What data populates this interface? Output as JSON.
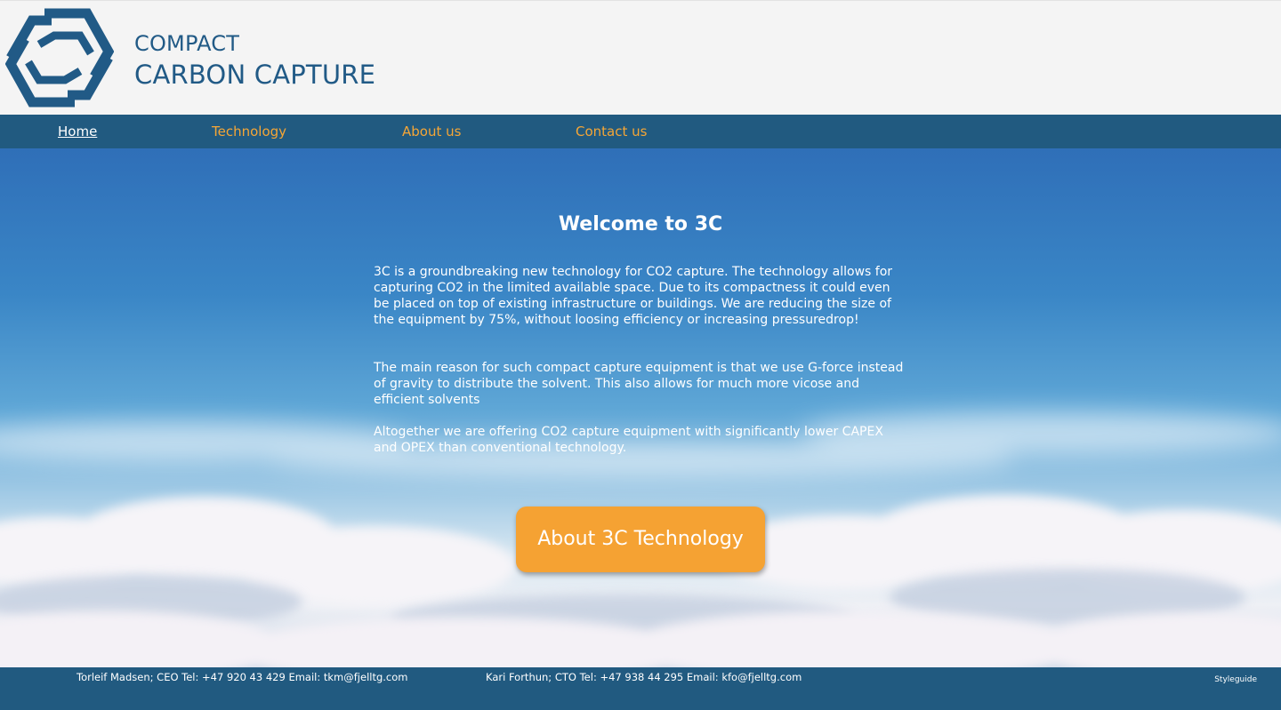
{
  "brand": {
    "line1": "COMPACT",
    "line2": "CARBON CAPTURE",
    "logo_icon": "hexagon-logo-icon",
    "color": "#215a86"
  },
  "nav": {
    "items": [
      {
        "label": "Home",
        "active": true
      },
      {
        "label": "Technology",
        "active": false
      },
      {
        "label": "About us",
        "active": false
      },
      {
        "label": "Contact us",
        "active": false
      }
    ],
    "background": "#215a80",
    "link_color": "#f5a636"
  },
  "hero": {
    "title": "Welcome to 3C",
    "paragraphs": [
      "3C is a groundbreaking new technology for CO2 capture. The technology allows for capturing CO2 in the limited available space. Due to its compactness it could even be placed on top of existing infrastructure or buildings. We are reducing the size of the equipment by 75%, without loosing efficiency or increasing pressuredrop!",
      "The main reason for such compact capture equipment is that we use G-force instead of gravity to distribute the solvent. This also allows for much more vicose and efficient solvents",
      "Altogether we are offering CO2 capture equipment with significantly lower CAPEX and OPEX than conventional technology."
    ],
    "cta_label": "About 3C Technology",
    "cta_color": "#f5a233"
  },
  "footer": {
    "contacts": [
      "Torleif Madsen; CEO Tel: +47 920 43 429 Email: tkm@fjelltg.com",
      "Kari Forthun; CTO Tel: +47 938 44 295 Email: kfo@fjelltg.com"
    ],
    "styleguide_label": "Styleguide"
  }
}
